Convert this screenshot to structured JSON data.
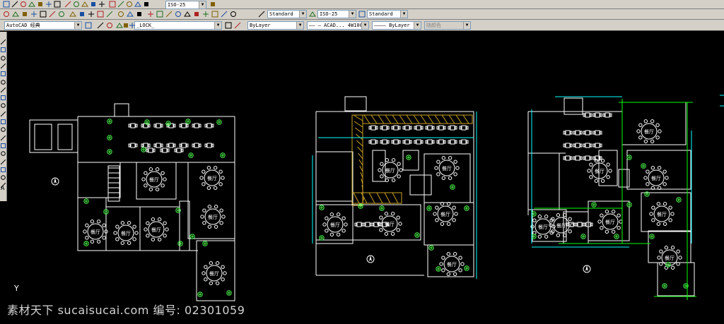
{
  "toolbar_top": {
    "dimstyle": "ISO-25"
  },
  "toolbar_std": {
    "text_style_label": "Standard",
    "dim_style_label": "ISO-25",
    "table_style_label": "Standard"
  },
  "toolbar_props": {
    "workspace": "AutoCAD 经典",
    "layer": "_LOCK_",
    "color": "ByLayer",
    "linetype": "—— — ACAD... 4W100",
    "lineweight": "———— ByLayer",
    "plotstyle": "随颜色"
  },
  "drawing": {
    "room_label": "餐厅",
    "grid_color": "#00ff00",
    "dim_color": "#00ffff",
    "plant_color": "#4dff4d",
    "hatch_color": "#c8a020"
  },
  "watermark": "素材天下 sucaisucai.com  编号: 02301059",
  "ucs_axis": "Y",
  "icons": [
    "new-icon",
    "open-icon",
    "save-icon",
    "print-icon",
    "undo-icon",
    "redo-icon",
    "zoom-icon",
    "pan-icon",
    "properties-icon",
    "layer-icon",
    "text-style-icon",
    "dim-style-icon",
    "table-style-icon",
    "line-icon",
    "circle-icon",
    "rectangle-icon",
    "arc-icon",
    "polygon-icon",
    "hatch-icon",
    "text-icon"
  ]
}
